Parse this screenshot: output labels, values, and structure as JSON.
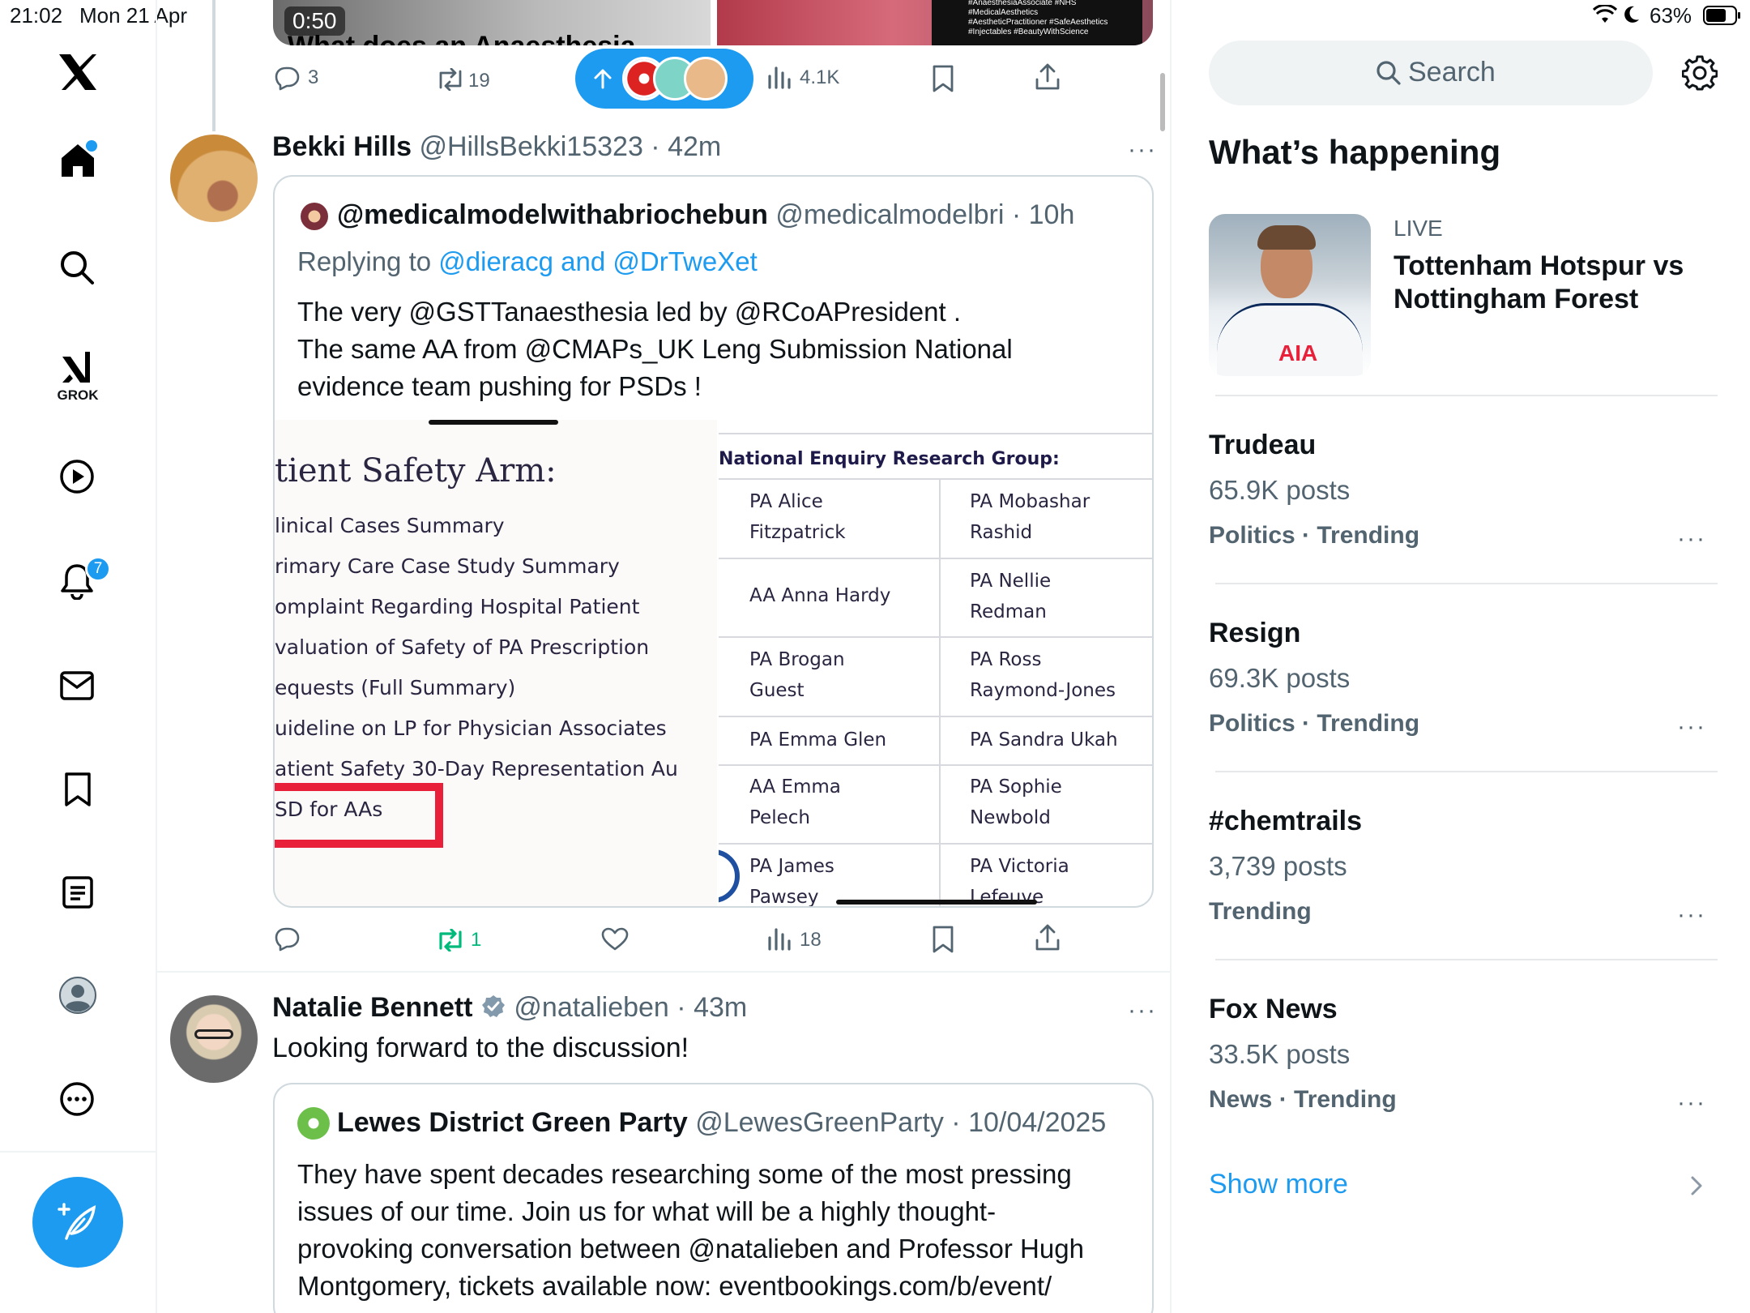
{
  "status_bar": {
    "time": "21:02",
    "date": "Mon 21 Apr",
    "battery": "63%"
  },
  "nav": {
    "items": [
      {
        "name": "x-logo"
      },
      {
        "name": "home"
      },
      {
        "name": "search"
      },
      {
        "name": "grok",
        "label": "GROK"
      },
      {
        "name": "videos"
      },
      {
        "name": "notifications",
        "badge": "7"
      },
      {
        "name": "messages"
      },
      {
        "name": "bookmarks"
      },
      {
        "name": "lists"
      },
      {
        "name": "profile"
      },
      {
        "name": "more"
      },
      {
        "name": "compose"
      }
    ]
  },
  "top_post": {
    "video_duration": "0:50",
    "video_caption": "What does an Anaesthesia...",
    "thumb_hashtags": [
      "#AnaesthesiaAssociate #NHS",
      "#MedicalAesthetics",
      "#AestheticPractitioner #SafeAesthetics",
      "#Injectables #BeautyWithScience"
    ],
    "replies": "3",
    "reposts": "19",
    "views": "4.1K"
  },
  "post1": {
    "author": "Bekki Hills",
    "handle": "@HillsBekki15323",
    "time": "42m",
    "quoted": {
      "author": "@medicalmodelwithabriochebun",
      "handle": "@medicalmodelbri",
      "time": "10h",
      "replying_prefix": "Replying to ",
      "replying_to": "@dieracg and @DrTweXet",
      "text_lines": [
        "The very @GSTTanaesthesia led by @RCoAPresident .",
        "The same AA from @CMAPs_UK Leng Submission National",
        "evidence team pushing for PSDs !"
      ],
      "doc_heading": "tient Safety Arm:",
      "doc_items": [
        "linical Cases Summary",
        "rimary Care Case Study Summary",
        "omplaint Regarding Hospital Patient",
        "valuation of Safety of PA Prescription",
        "equests (Full Summary)",
        "uideline on LP for Physician Associates",
        "atient Safety 30-Day Representation Au",
        "SD for AAs"
      ],
      "table_title": "National Enquiry Research Group:",
      "table_rows": [
        [
          "PA Alice\nFitzpatrick",
          "PA Mobashar\nRashid"
        ],
        [
          "AA Anna Hardy",
          "PA Nellie\nRedman"
        ],
        [
          "PA Brogan\nGuest",
          "PA Ross\nRaymond-Jones"
        ],
        [
          "PA Emma Glen",
          "PA Sandra Ukah"
        ],
        [
          "AA Emma\nPelech",
          "PA Sophie\nNewbold"
        ],
        [
          "PA James\nPawsey",
          "PA Victoria\nLefeuve"
        ]
      ]
    },
    "reposts": "1",
    "views": "18"
  },
  "post2": {
    "author": "Natalie Bennett",
    "handle": "@natalieben",
    "time": "43m",
    "text": "Looking forward to the discussion!",
    "quoted": {
      "author": "Lewes District Green Party",
      "handle": "@LewesGreenParty",
      "date": "10/04/2025",
      "text_lines": [
        "They have spent decades researching some of the most pressing",
        "issues of our time. Join us for what will be a highly thought-",
        "provoking conversation between @natalieben and Professor Hugh",
        "Montgomery, tickets available now: eventbookings.com/b/event/"
      ]
    }
  },
  "sidebar": {
    "search_placeholder": "Search",
    "heading": "What’s happening",
    "live": {
      "label": "LIVE",
      "title_lines": [
        "Tottenham Hotspur vs",
        "Nottingham Forest"
      ],
      "shirt_text": "AIA"
    },
    "trends": [
      {
        "title": "Trudeau",
        "count": "65.9K posts",
        "category": "Politics · Trending"
      },
      {
        "title": "Resign",
        "count": "69.3K posts",
        "category": "Politics · Trending"
      },
      {
        "title": "#chemtrails",
        "count": "3,739 posts",
        "category": "Trending"
      },
      {
        "title": "Fox News",
        "count": "33.5K posts",
        "category": "News · Trending"
      }
    ],
    "show_more": "Show more"
  },
  "colors": {
    "accent": "#1d9bf0",
    "repost_active": "#00ba7c",
    "highlight_box": "#e8203a"
  }
}
